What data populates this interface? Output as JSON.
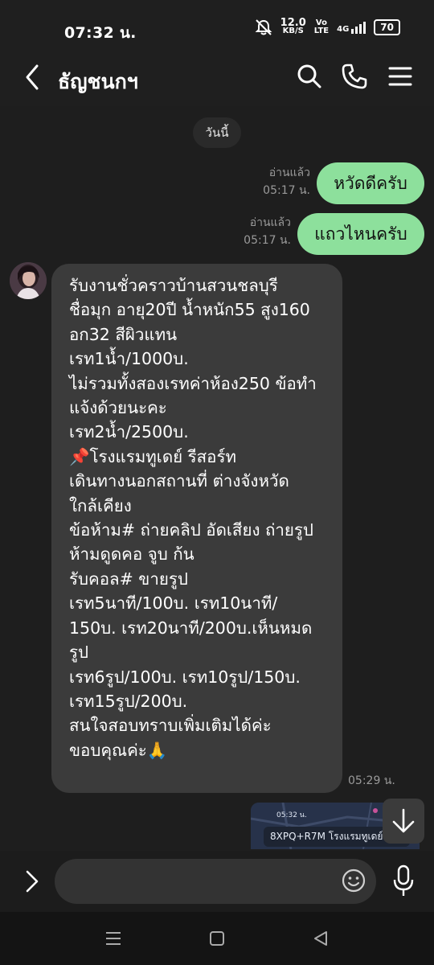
{
  "status_bar": {
    "time": "07:32 น.",
    "net_speed": "12.0",
    "net_unit": "KB/S",
    "volte_top": "Vo",
    "volte_bottom": "LTE",
    "network": "4G",
    "battery": "70",
    "icons": [
      "mute-icon",
      "signal-icon",
      "battery-icon"
    ]
  },
  "header": {
    "title": "ธัญชนกฯ",
    "icons": [
      "back-arrow-icon",
      "search-icon",
      "phone-icon",
      "menu-icon"
    ]
  },
  "chat": {
    "date_separator": "วันนี้",
    "sent_messages": [
      {
        "text": "หวัดดีครับ",
        "read_status": "อ่านแล้ว",
        "time": "05:17 น."
      },
      {
        "text": "แถวไหนครับ",
        "read_status": "อ่านแล้ว",
        "time": "05:17 น."
      }
    ],
    "received_message": {
      "lines": [
        "รับงานชั่วคราวบ้านสวนชลบุรี",
        "ชื่อมุก อายุ20ปี น้ำหนัก55 สูง160",
        "อก32 สีผิวแทน",
        "เรท1น้ำ/1000บ.",
        "ไม่รวมทั้งสองเรทค่าห้อง250 ข้อทำ",
        "แจ้งด้วยนะคะ",
        "เรท2น้ำ/2500บ.",
        "📌โรงแรมทูเดย์ รีสอร์ท",
        "เดินทางนอกสถานที่ ต่างจังหวัด",
        "ใกล้เคียง",
        "ข้อห้าม# ถ่ายคลิป อัดเสียง ถ่ายรูป",
        "ห้ามดูดคอ จูบ ก้น",
        "รับคอล# ขายรูป",
        "เรท5นาที/100บ. เรท10นาที/",
        "150บ. เรท20นาที/200บ.เห็นหมด",
        "รูป",
        "เรท6รูป/100บ. เรท10รูป/150บ.",
        "เรท15รูป/200บ.",
        "สนใจสอบทราบเพิ่มเติมได้ค่ะ",
        "ขอบคุณค่ะ🙏"
      ],
      "time": "05:29 น."
    },
    "image_message": {
      "inner_time": "05:32 น.",
      "caption": "8XPQ+R7M โรงแรมทูเดย์รีส..."
    }
  },
  "input": {
    "placeholder": ""
  },
  "colors": {
    "sent_bubble": "#8de09c",
    "received_bubble": "#3b3b3b",
    "background": "#1e1e1e"
  }
}
